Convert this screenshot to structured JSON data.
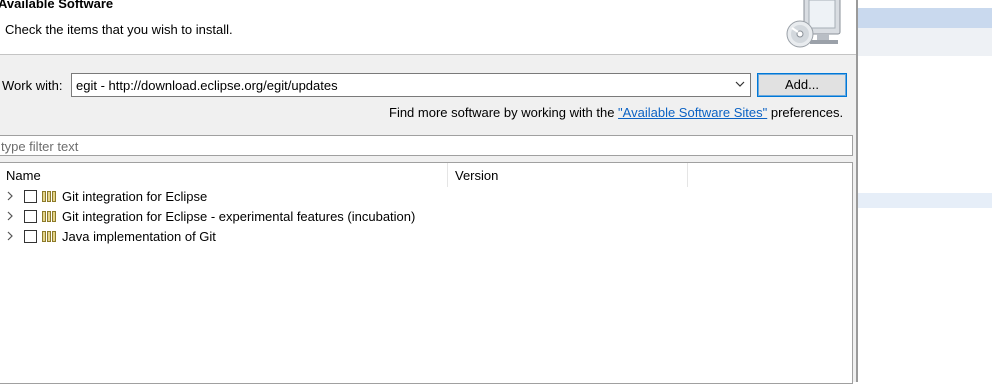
{
  "dialog": {
    "title": "Available Software",
    "subtitle": "Check the items that you wish to install."
  },
  "work_with": {
    "label": "Work with:",
    "value": "egit - http://download.eclipse.org/egit/updates",
    "add_label": "Add..."
  },
  "find_more": {
    "prefix": "Find more software by working with the ",
    "link": "\"Available Software Sites\"",
    "suffix": " preferences."
  },
  "filter": {
    "placeholder": "type filter text"
  },
  "table": {
    "columns": [
      "Name",
      "Version"
    ],
    "rows": [
      {
        "label": "Git integration for Eclipse",
        "checked": false
      },
      {
        "label": "Git integration for Eclipse - experimental features  (incubation)",
        "checked": false
      },
      {
        "label": "Java implementation of Git",
        "checked": false
      }
    ]
  },
  "icons": {
    "banner": "install-cd-monitor-icon",
    "expander": "chevron-right-icon",
    "feature": "feature-category-icon",
    "combo_arrow": "chevron-down-icon"
  },
  "colors": {
    "accent": "#0078d7",
    "link": "#0b62c4"
  }
}
